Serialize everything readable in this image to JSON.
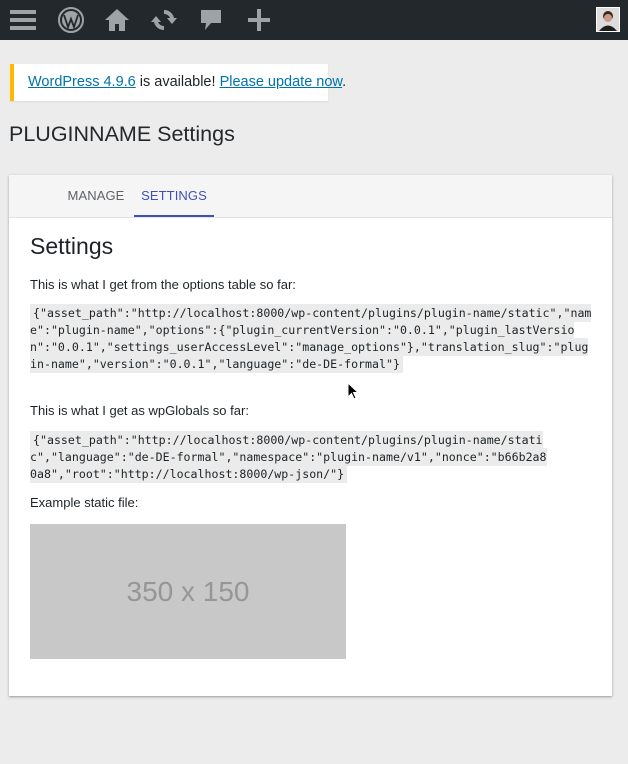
{
  "adminbar": {
    "icons": [
      "menu-icon",
      "wordpress-logo-icon",
      "home-icon",
      "updates-icon",
      "comments-icon",
      "new-content-icon",
      "avatar"
    ]
  },
  "notice": {
    "link1": "WordPress 4.9.6",
    "middle": " is available! ",
    "link2": "Please update now",
    "end": "."
  },
  "page_title": "PLUGINNAME Settings",
  "tabs": [
    {
      "label": "MANAGE",
      "active": false
    },
    {
      "label": "SETTINGS",
      "active": true
    }
  ],
  "content": {
    "heading": "Settings",
    "options_label": "This is what I get from the options table so far:",
    "options_json": "{\"asset_path\":\"http://localhost:8000/wp-content/plugins/plugin-name/static\",\"name\":\"plugin-name\",\"options\":{\"plugin_currentVersion\":\"0.0.1\",\"plugin_lastVersion\":\"0.0.1\",\"settings_userAccessLevel\":\"manage_options\"},\"translation_slug\":\"plugin-name\",\"version\":\"0.0.1\",\"language\":\"de-DE-formal\"}",
    "globals_label": "This is what I get as wpGlobals so far:",
    "globals_json": "{\"asset_path\":\"http://localhost:8000/wp-content/plugins/plugin-name/static\",\"language\":\"de-DE-formal\",\"namespace\":\"plugin-name/v1\",\"nonce\":\"b66b2a80a8\",\"root\":\"http://localhost:8000/wp-json/\"}",
    "static_label": "Example static file:",
    "image_text": "350 x 150"
  },
  "colors": {
    "adminbar": "#23282d",
    "notice_border": "#ffb900",
    "link": "#0073aa",
    "tab_active": "#3f51b5"
  }
}
